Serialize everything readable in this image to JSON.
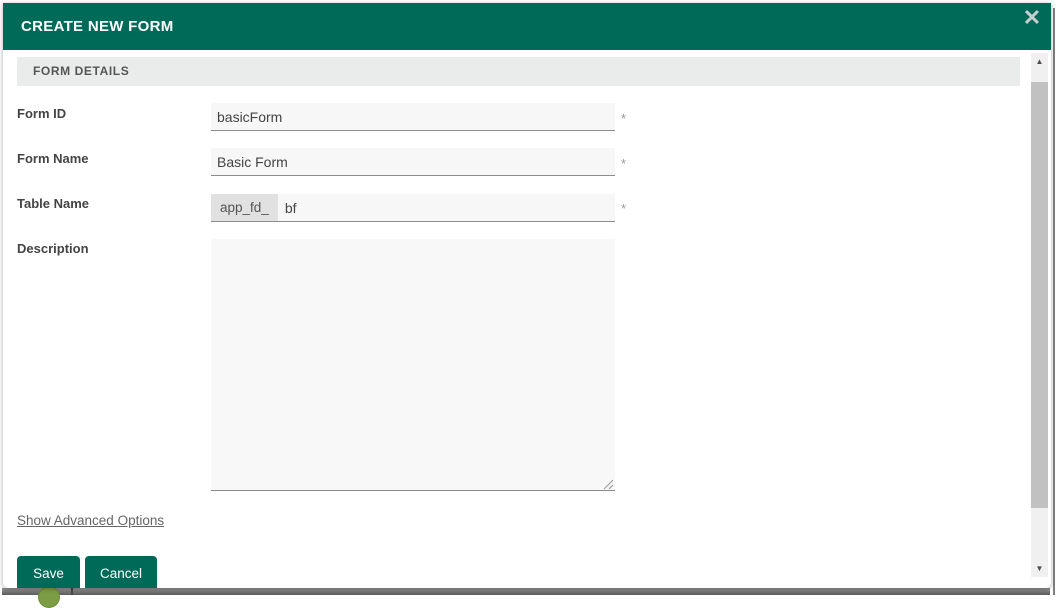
{
  "window": {
    "title": "CREATE NEW FORM",
    "close_icon": "✕"
  },
  "form": {
    "section_header": "FORM DETAILS",
    "fields": {
      "form_id": {
        "label": "Form ID",
        "value": "basicForm",
        "required_marker": "*"
      },
      "form_name": {
        "label": "Form Name",
        "value": "Basic Form",
        "required_marker": "*"
      },
      "table_name": {
        "label": "Table Name",
        "prefix": "app_fd_",
        "value": "bf",
        "required_marker": "*"
      },
      "description": {
        "label": "Description",
        "value": ""
      }
    },
    "advanced_options_link": "Show Advanced Options",
    "save_button": "Save",
    "cancel_button": "Cancel"
  },
  "scrollbar": {
    "up_arrow": "▲",
    "down_arrow": "▼"
  },
  "colors": {
    "accent_teal": "#006a58",
    "header_text": "#ffffff",
    "section_bg": "#eaecec",
    "input_bg": "#f7f7f7",
    "prefix_bg": "#e1e1e1",
    "link_gray": "#666666",
    "scrollbar_thumb": "#c1c1c1",
    "backdrop_bar_gray": "#6f6f6f",
    "background_logo_green": "#7d9d45"
  }
}
